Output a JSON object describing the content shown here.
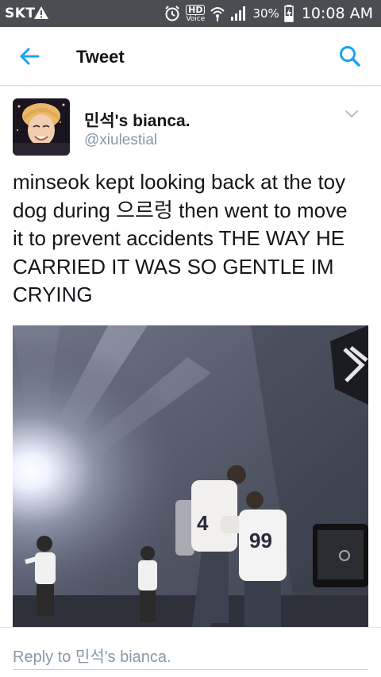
{
  "status_bar": {
    "carrier": "SKT",
    "hd_label": "HD",
    "hd_sub": "Voice",
    "battery": "30%",
    "time": "10:08 AM"
  },
  "header": {
    "title": "Tweet",
    "back_icon": "arrow-left-icon",
    "search_icon": "search-icon",
    "accent": "#1da1f2"
  },
  "tweet": {
    "author_name": "민석's bianca.",
    "author_handle": "@xiulestial",
    "text": "minseok kept looking back at the toy dog during 으르렁 then went to move it to prevent accidents THE WAY HE CARRIED IT WAS SO GENTLE IM CRYING",
    "jersey_numbers": [
      "4",
      "99"
    ]
  },
  "reply": {
    "placeholder": "Reply to 민석's bianca."
  }
}
